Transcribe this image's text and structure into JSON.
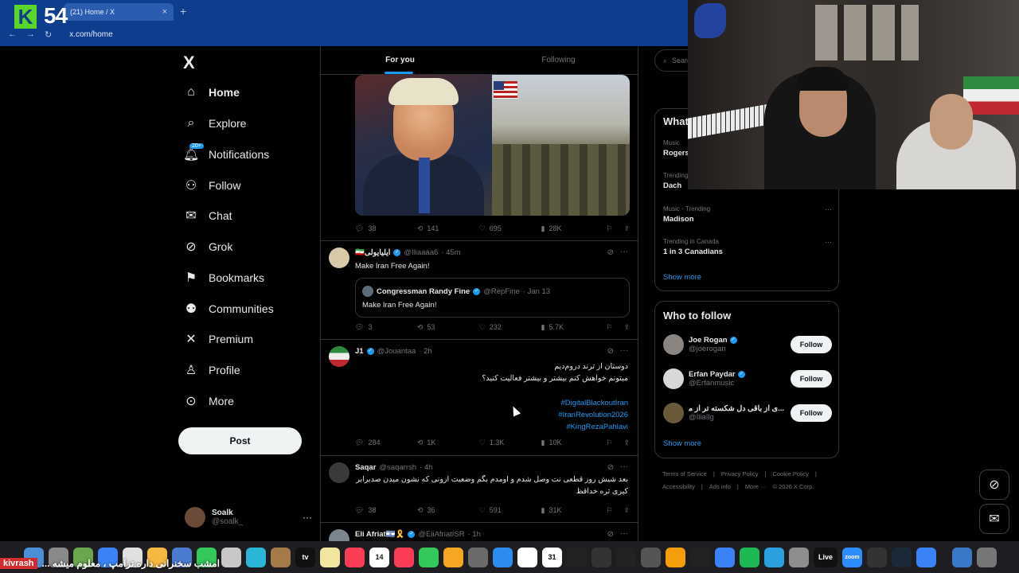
{
  "overlay": {
    "logo_k": "K",
    "logo_number": "54"
  },
  "browser": {
    "tab_title": "(21) Home / X",
    "tab_close": "×",
    "new_tab": "+",
    "url": "x.com/home"
  },
  "nav": {
    "logo": "X",
    "notifications_badge": "20+",
    "items": [
      {
        "label": "Home",
        "icon": "home-icon"
      },
      {
        "label": "Explore",
        "icon": "search-icon"
      },
      {
        "label": "Notifications",
        "icon": "bell-icon"
      },
      {
        "label": "Follow",
        "icon": "person-plus-icon"
      },
      {
        "label": "Chat",
        "icon": "mail-icon"
      },
      {
        "label": "Grok",
        "icon": "grok-icon"
      },
      {
        "label": "Bookmarks",
        "icon": "bookmark-icon"
      },
      {
        "label": "Communities",
        "icon": "communities-icon"
      },
      {
        "label": "Premium",
        "icon": "x-icon"
      },
      {
        "label": "Profile",
        "icon": "person-icon"
      },
      {
        "label": "More",
        "icon": "more-circle-icon"
      }
    ],
    "post_button": "Post",
    "account": {
      "name": "Soalk",
      "handle": "@soalk_"
    }
  },
  "timeline": {
    "tabs": [
      "For you",
      "Following"
    ],
    "first_tweet_actions": {
      "replies": "38",
      "reposts": "141",
      "likes": "695",
      "views": "28K"
    },
    "tweets": [
      {
        "name": "🇮🇷ایلیایولی",
        "handle": "@Iliaaaa6",
        "time": "· 45m",
        "text": "Make Iran Free Again!",
        "quote": {
          "name": "Congressman Randy Fine",
          "handle": "@RepFine",
          "time": "· Jan 13",
          "text": "Make Iran Free Again!"
        },
        "actions": {
          "replies": "3",
          "reposts": "53",
          "likes": "232",
          "views": "5.7K"
        }
      },
      {
        "name": "J1",
        "handle": "@Jouantaa",
        "time": "· 2h",
        "text_lines": [
          "دوستان از ترند دروم‌دیم",
          "میتونم خواهش کنم بیشتر و بیشتر فعالیت کنید؟"
        ],
        "hashtags": [
          "#DigitalBlackoutIran",
          "#IranRevolution2026",
          "#KingRezaPahlavi"
        ],
        "actions": {
          "replies": "284",
          "reposts": "1K",
          "likes": "1.3K",
          "views": "10K"
        }
      },
      {
        "name": "Saqar",
        "handle": "@saqarrsh",
        "time": "· 4h",
        "text_lines": [
          "بعد شیش روز قطعی نت وصل شدم و اومدم بگم وضعیت ازونی که نشون میدن صدبرابر",
          "کیری تره خداقظ"
        ],
        "actions": {
          "replies": "38",
          "reposts": "36",
          "likes": "591",
          "views": "31K"
        }
      },
      {
        "name": "Eli Afriat🇮🇱🎗️",
        "handle": "@EliAfriatISR",
        "time": "· 1h"
      }
    ]
  },
  "sidebar": {
    "search_placeholder": "Search",
    "trends_title": "What's happening",
    "trends": [
      {
        "context": "Music",
        "name": "Rogers"
      },
      {
        "context": "Trending",
        "name": "Dach"
      },
      {
        "context": "Music · Trending",
        "name": "Madison"
      },
      {
        "context": "Trending in Canada",
        "name": "1 in 3 Canadians"
      }
    ],
    "trends_show_more": "Show more",
    "who_to_follow_title": "Who to follow",
    "who_to_follow": [
      {
        "name": "Joe Rogan",
        "handle": "@joerogan",
        "button": "Follow"
      },
      {
        "name": "Erfan Paydar",
        "handle": "@Erfanmusic",
        "button": "Follow"
      },
      {
        "name": "...ی از باقی دل شکسته تر از مجنون",
        "handle": "@IliaIlg",
        "button": "Follow"
      }
    ],
    "wtf_show_more": "Show more",
    "footer": [
      "Terms of Service",
      "|",
      "Privacy Policy",
      "|",
      "Cookie Policy",
      "|",
      "Accessibility",
      "|",
      "Ads info",
      "|",
      "More ···",
      "© 2026 X Corp."
    ]
  },
  "ticker": {
    "brand": "kivrash",
    "message": "امشب سخنرانی داره ترامپ ، معلوم میشه ..."
  },
  "dock": {
    "labels": [
      "tv",
      "14",
      "31",
      "Live",
      "zoom"
    ]
  },
  "colors": {
    "accent": "#1d9bf0",
    "background": "#000000",
    "border": "#2f3336",
    "chrome": "#0d3d8c"
  }
}
